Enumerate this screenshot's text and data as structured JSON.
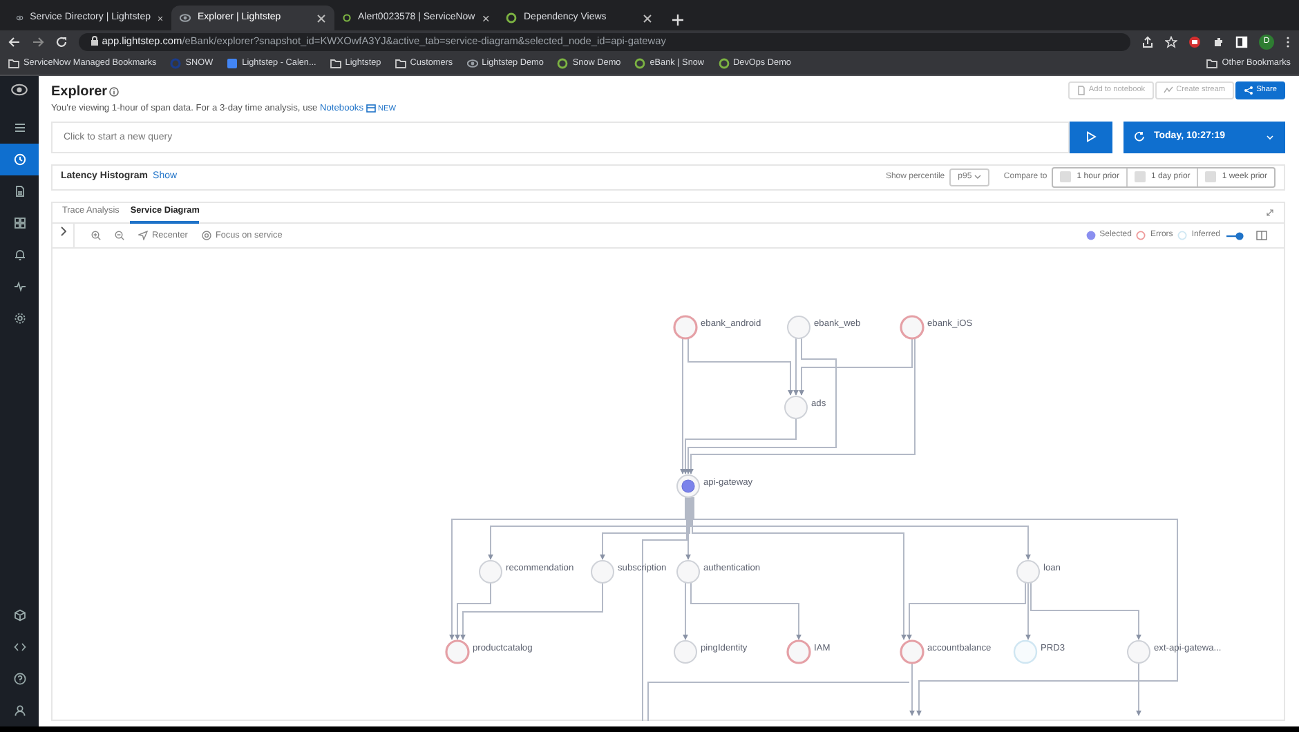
{
  "browser": {
    "tabs": [
      {
        "label": "Service Directory | Lightstep",
        "selected": false
      },
      {
        "label": "Explorer | Lightstep",
        "selected": true
      },
      {
        "label": "Alert0023578 | ServiceNow",
        "selected": false
      },
      {
        "label": "Dependency Views",
        "selected": false
      }
    ],
    "address": {
      "host": "app.lightstep.com",
      "path": "/eBank/explorer?snapshot_id=KWXOwfA3YJ&active_tab=service-diagram&selected_node_id=api-gateway"
    },
    "profile": "D",
    "bookmarks": [
      "ServiceNow Managed Bookmarks",
      "SNOW",
      "Lightstep - Calen...",
      "Lightstep",
      "Customers",
      "Lightstep Demo",
      "Snow Demo",
      "eBank | Snow",
      "DevOps Demo"
    ],
    "other_bookmarks": "Other Bookmarks"
  },
  "sidebar": {
    "items": [
      {
        "selected": false
      },
      {
        "selected": true
      },
      {
        "selected": false
      },
      {
        "selected": false
      },
      {
        "selected": false
      },
      {
        "selected": false
      },
      {
        "selected": false
      }
    ]
  },
  "explorer": {
    "title": "Explorer",
    "subtitle": "You're viewing 1-hour of span data. For a 3-day time analysis, use",
    "link": "Notebooks",
    "badge": "NEW",
    "actions": [
      {
        "label": "Add to notebook",
        "kind": "outline"
      },
      {
        "label": "Create stream",
        "kind": "outline"
      },
      {
        "label": "Share",
        "kind": "primary"
      }
    ]
  },
  "query": {
    "placeholder": "Click to start a new query",
    "time": "Today, 10:27:19"
  },
  "latency": {
    "title": "Latency Histogram",
    "show": "Show",
    "percentile_label": "Show percentile",
    "percentile": "p95",
    "compare_label": "Compare to",
    "compare": [
      {
        "label": "1 hour prior",
        "checked": false
      },
      {
        "label": "1 day prior",
        "checked": false
      },
      {
        "label": "1 week prior",
        "checked": false
      }
    ]
  },
  "view_tabs": [
    {
      "label": "Trace Analysis",
      "selected": false
    },
    {
      "label": "Service Diagram",
      "selected": true
    }
  ],
  "toolbar": {
    "recenter": "Recenter",
    "focus": "Focus on service"
  },
  "legend": [
    {
      "label": "Selected",
      "kind": "selected"
    },
    {
      "label": "Errors",
      "kind": "error"
    },
    {
      "label": "Inferred",
      "kind": "inferred"
    }
  ],
  "inferred_toggle": {
    "on": true
  },
  "nodes": [
    {
      "label": "ebank_android",
      "kind": "error"
    },
    {
      "label": "ebank_web",
      "kind": "normal"
    },
    {
      "label": "ebank_iOS",
      "kind": "error"
    },
    {
      "label": "ads",
      "kind": "normal"
    },
    {
      "label": "api-gateway",
      "kind": "selected"
    },
    {
      "label": "recommendation",
      "kind": "normal"
    },
    {
      "label": "subscription",
      "kind": "normal"
    },
    {
      "label": "authentication",
      "kind": "normal"
    },
    {
      "label": "loan",
      "kind": "normal"
    },
    {
      "label": "productcatalog",
      "kind": "error"
    },
    {
      "label": "pingIdentity",
      "kind": "normal"
    },
    {
      "label": "IAM",
      "kind": "error"
    },
    {
      "label": "accountbalance",
      "kind": "error"
    },
    {
      "label": "PRD3",
      "kind": "inferred"
    },
    {
      "label": "ext-api-gatewa...",
      "kind": "normal"
    }
  ]
}
